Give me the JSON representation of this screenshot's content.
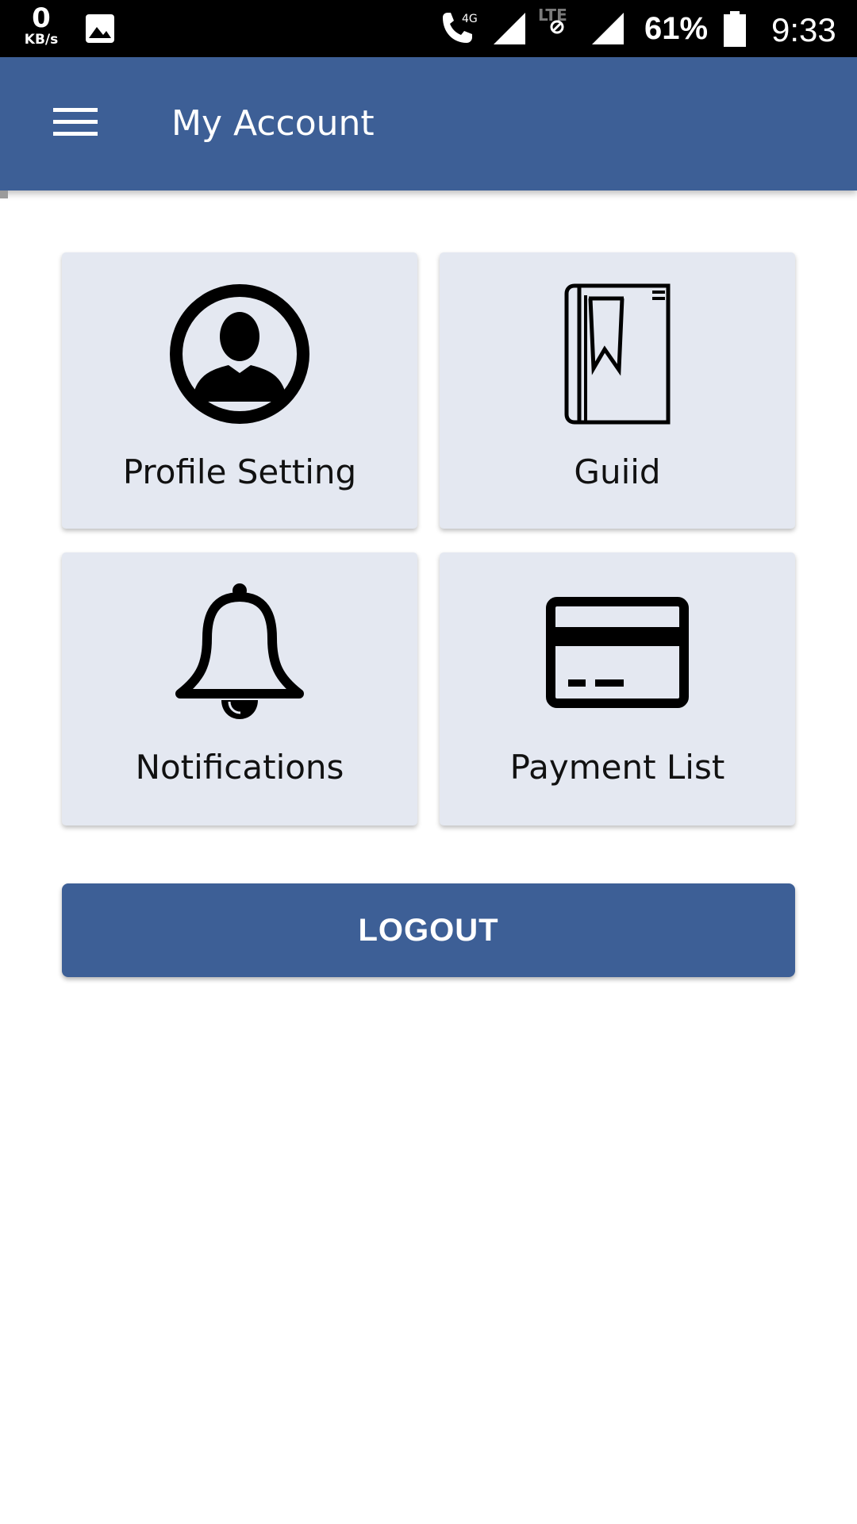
{
  "status_bar": {
    "speed_value": "0",
    "speed_unit": "KB/s",
    "network_label": "4G",
    "lte_label": "LTE",
    "battery_percent": "61%",
    "time": "9:33",
    "icons": [
      "gallery-icon",
      "wifi-calling-icon",
      "signal-icon",
      "lte-icon",
      "signal-icon",
      "battery-icon"
    ]
  },
  "app_bar": {
    "title": "My Account",
    "menu_icon": "hamburger-menu-icon",
    "color": "#3d5f96"
  },
  "grid": {
    "items": [
      {
        "label": "Profile Setting",
        "icon": "profile-icon"
      },
      {
        "label": "Guiid",
        "icon": "book-icon"
      },
      {
        "label": "Notifications",
        "icon": "bell-icon"
      },
      {
        "label": "Payment List",
        "icon": "credit-card-icon"
      }
    ],
    "card_color": "#e4e8f1"
  },
  "logout": {
    "label": "LOGOUT",
    "color": "#3d5f96"
  }
}
